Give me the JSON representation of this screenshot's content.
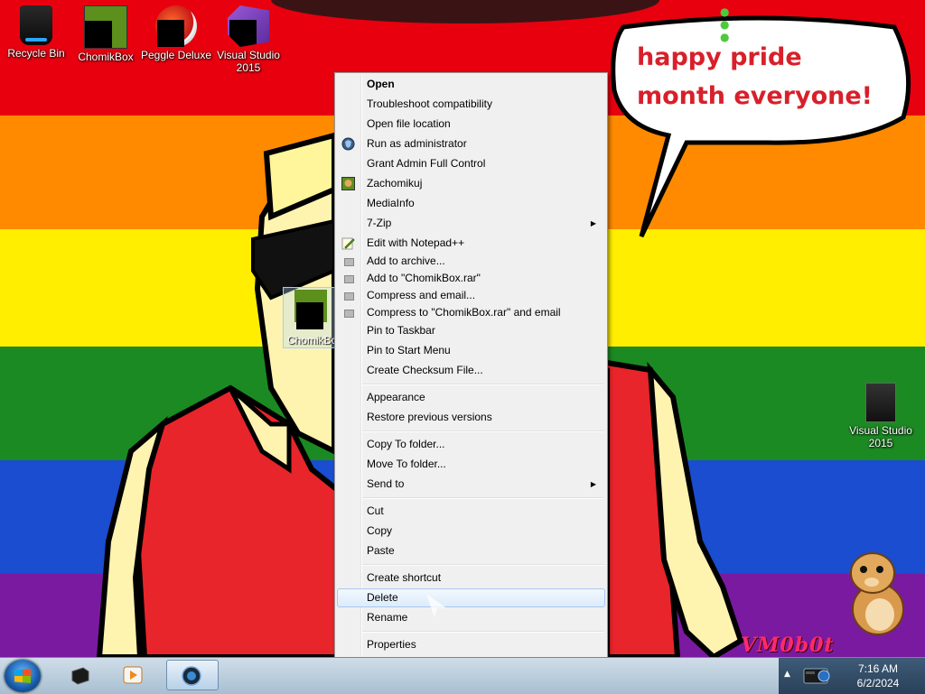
{
  "desktop": {
    "speech_bubble": "happy pride month everyone!",
    "watermark": "VM0b0t",
    "icons": [
      {
        "label": "Recycle Bin"
      },
      {
        "label": "ChomikBox"
      },
      {
        "label": "Peggle Deluxe"
      },
      {
        "label": "Visual Studio 2015"
      },
      {
        "label": "Visual Studio 2015"
      }
    ],
    "dragged_icon_label": "ChomikBox"
  },
  "context_menu": {
    "items": [
      {
        "label": "Open",
        "icon": "",
        "bold": true
      },
      {
        "label": "Troubleshoot compatibility",
        "icon": ""
      },
      {
        "label": "Open file location",
        "icon": ""
      },
      {
        "label": "Run as administrator",
        "icon": "uac-shield-icon"
      },
      {
        "label": "Grant Admin Full Control",
        "icon": ""
      },
      {
        "label": "Zachomikuj",
        "icon": "chomikbox-icon"
      },
      {
        "label": "MediaInfo",
        "icon": ""
      },
      {
        "label": "7-Zip",
        "icon": "",
        "submenu": true
      },
      {
        "label": "Edit with Notepad++",
        "icon": "notepad-plus-plus-icon"
      },
      {
        "label": "Add to archive...",
        "icon": "winrar-icon"
      },
      {
        "label": "Add to \"ChomikBox.rar\"",
        "icon": "winrar-icon"
      },
      {
        "label": "Compress and email...",
        "icon": "winrar-icon"
      },
      {
        "label": "Compress to \"ChomikBox.rar\" and email",
        "icon": "winrar-icon"
      },
      {
        "label": "Pin to Taskbar",
        "icon": ""
      },
      {
        "label": "Pin to Start Menu",
        "icon": ""
      },
      {
        "label": "Create Checksum File...",
        "icon": ""
      },
      {
        "label": "Appearance",
        "icon": ""
      },
      {
        "label": "Restore previous versions",
        "icon": ""
      },
      {
        "label": "Copy To folder...",
        "icon": ""
      },
      {
        "label": "Move To folder...",
        "icon": ""
      },
      {
        "label": "Send to",
        "icon": "",
        "submenu": true
      },
      {
        "label": "Cut",
        "icon": ""
      },
      {
        "label": "Copy",
        "icon": ""
      },
      {
        "label": "Paste",
        "icon": ""
      },
      {
        "label": "Create shortcut",
        "icon": ""
      },
      {
        "label": "Delete",
        "icon": "",
        "highlighted": true
      },
      {
        "label": "Rename",
        "icon": ""
      },
      {
        "label": "Properties",
        "icon": ""
      }
    ]
  },
  "taskbar": {
    "clock_time": "7:16 AM",
    "clock_date": "6/2/2024"
  },
  "colors": {
    "menu_bg": "#f0f0f0",
    "highlight_border": "#a8caf0",
    "bubble_text": "#d8202a"
  }
}
